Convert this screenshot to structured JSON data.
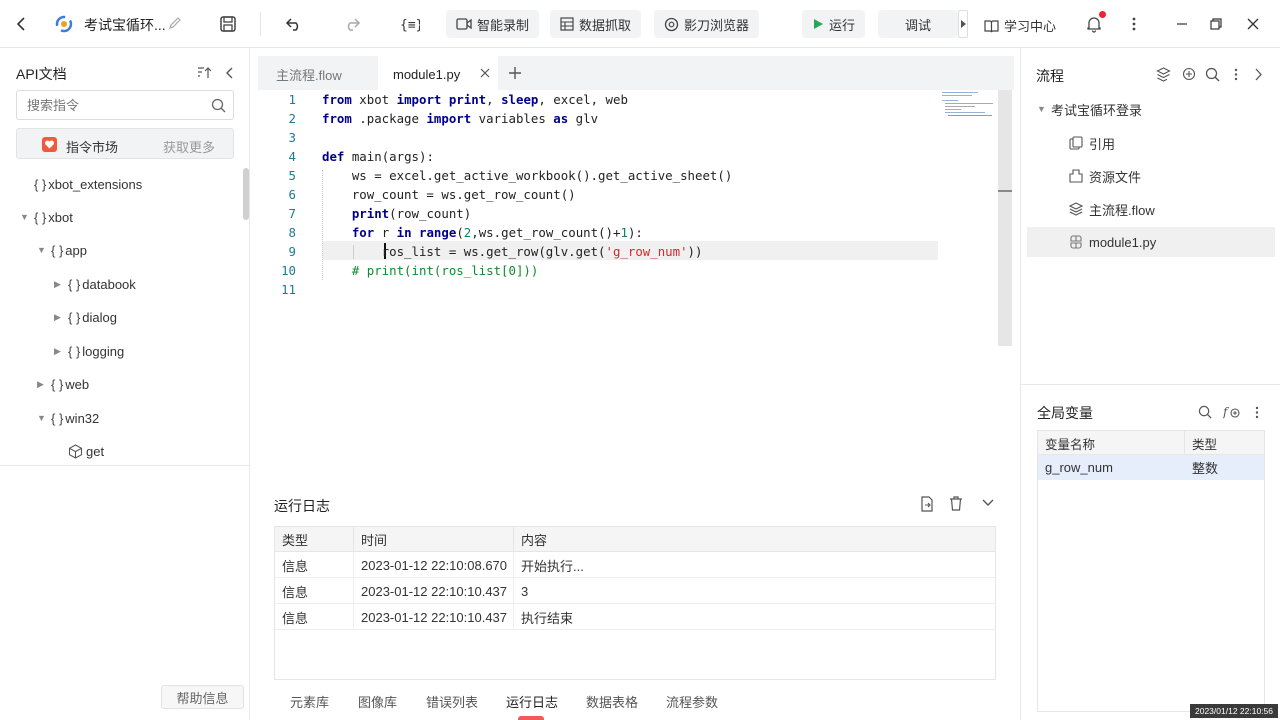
{
  "topbar": {
    "project_title": "考试宝循环...",
    "smart_record": "智能录制",
    "data_capture": "数据抓取",
    "browser": "影刀浏览器",
    "run": "运行",
    "debug": "调试",
    "learn": "学习中心"
  },
  "left_panel": {
    "title": "API文档",
    "search_placeholder": "搜索指令",
    "market_label": "指令市场",
    "market_more": "获取更多",
    "tree": [
      {
        "label": "xbot_extensions",
        "type": "module",
        "expanded": false
      },
      {
        "label": "xbot",
        "type": "module",
        "expanded": true
      },
      {
        "label": "app",
        "type": "module",
        "expanded": true
      },
      {
        "label": "databook",
        "type": "module",
        "expanded": false
      },
      {
        "label": "dialog",
        "type": "module",
        "expanded": false
      },
      {
        "label": "logging",
        "type": "module",
        "expanded": false
      },
      {
        "label": "web",
        "type": "module",
        "expanded": false
      },
      {
        "label": "win32",
        "type": "module",
        "expanded": true
      },
      {
        "label": "get",
        "type": "function"
      }
    ],
    "help_button": "帮助信息"
  },
  "editor": {
    "tabs": [
      {
        "label": "主流程.flow",
        "active": false
      },
      {
        "label": "module1.py",
        "active": true
      }
    ],
    "lines": [
      "1",
      "2",
      "3",
      "4",
      "5",
      "6",
      "7",
      "8",
      "9",
      "10",
      "11"
    ]
  },
  "log": {
    "title": "运行日志",
    "headers": {
      "type": "类型",
      "time": "时间",
      "content": "内容"
    },
    "rows": [
      {
        "type": "信息",
        "time": "2023-01-12 22:10:08.670",
        "content": "开始执行..."
      },
      {
        "type": "信息",
        "time": "2023-01-12 22:10:10.437",
        "content": "3"
      },
      {
        "type": "信息",
        "time": "2023-01-12 22:10:10.437",
        "content": "执行结束"
      }
    ],
    "bottom_tabs": [
      "元素库",
      "图像库",
      "错误列表",
      "运行日志",
      "数据表格",
      "流程参数"
    ]
  },
  "right_panel": {
    "flow_title": "流程",
    "project_name": "考试宝循环登录",
    "items": [
      "引用",
      "资源文件",
      "主流程.flow",
      "module1.py"
    ],
    "globals_title": "全局变量",
    "var_headers": {
      "name": "变量名称",
      "type": "类型"
    },
    "vars": [
      {
        "name": "g_row_num",
        "type": "整数"
      }
    ]
  },
  "clock": "2023/01/12 22:10:56",
  "colors": {
    "accent": "#2f6bea",
    "selection": "#e6eefc",
    "play": "#2aa65a",
    "badge": "#f5222d"
  }
}
